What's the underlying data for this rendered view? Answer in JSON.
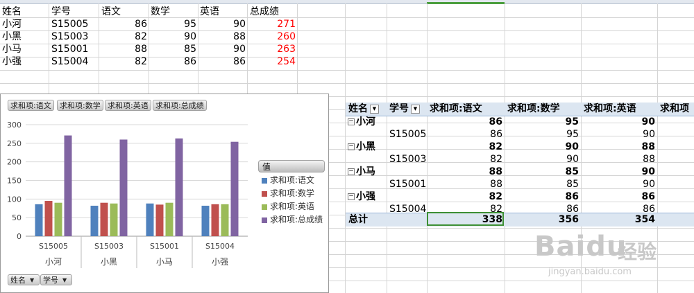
{
  "source_table": {
    "headers": [
      "姓名",
      "学号",
      "语文",
      "数学",
      "英语",
      "总成绩"
    ],
    "rows": [
      {
        "name": "小河",
        "id": "S15005",
        "chinese": "86",
        "math": "95",
        "english": "90",
        "total": "271"
      },
      {
        "name": "小黑",
        "id": "S15003",
        "chinese": "82",
        "math": "90",
        "english": "88",
        "total": "260"
      },
      {
        "name": "小马",
        "id": "S15001",
        "chinese": "88",
        "math": "85",
        "english": "90",
        "total": "263"
      },
      {
        "name": "小强",
        "id": "S15004",
        "chinese": "82",
        "math": "86",
        "english": "86",
        "total": "254"
      }
    ]
  },
  "chart_buttons": [
    "求和项:语文",
    "求和项:数学",
    "求和项:英语",
    "求和项:总成绩"
  ],
  "axis_buttons": [
    "姓名",
    "学号"
  ],
  "legend_title": "值",
  "chart_data": {
    "type": "bar",
    "categories": [
      "S15005",
      "S15003",
      "S15001",
      "S15004"
    ],
    "category_groups": [
      "小河",
      "小黑",
      "小马",
      "小强"
    ],
    "series": [
      {
        "name": "求和项:语文",
        "values": [
          86,
          82,
          88,
          82
        ],
        "color": "#4f81bd"
      },
      {
        "name": "求和项:数学",
        "values": [
          95,
          90,
          85,
          86
        ],
        "color": "#c0504d"
      },
      {
        "name": "求和项:英语",
        "values": [
          90,
          88,
          90,
          86
        ],
        "color": "#9bbb59"
      },
      {
        "name": "求和项:总成绩",
        "values": [
          271,
          260,
          263,
          254
        ],
        "color": "#8064a2"
      }
    ],
    "ylim": [
      0,
      300
    ],
    "yticks": [
      "0",
      "50",
      "100",
      "150",
      "200",
      "250",
      "300"
    ],
    "grid": true,
    "legend_position": "right"
  },
  "pivot": {
    "headers": [
      "姓名",
      "学号",
      "求和项:语文",
      "求和项:数学",
      "求和项:英语",
      "求和项"
    ],
    "groups": [
      {
        "name": "小河",
        "sum": [
          "86",
          "95",
          "90"
        ],
        "id": "S15005",
        "vals": [
          "86",
          "95",
          "90"
        ]
      },
      {
        "name": "小黑",
        "sum": [
          "82",
          "90",
          "88"
        ],
        "id": "S15003",
        "vals": [
          "82",
          "90",
          "88"
        ]
      },
      {
        "name": "小马",
        "sum": [
          "88",
          "85",
          "90"
        ],
        "id": "S15001",
        "vals": [
          "88",
          "85",
          "90"
        ]
      },
      {
        "name": "小强",
        "sum": [
          "82",
          "86",
          "86"
        ],
        "id": "S15004",
        "vals": [
          "82",
          "86",
          "86"
        ]
      }
    ],
    "total_label": "总计",
    "totals": [
      "338",
      "356",
      "354"
    ]
  },
  "watermark": {
    "brand": "Baidu",
    "brand_cn": "经验",
    "url": "jingyan.baidu.com"
  },
  "colors": {
    "accent_green": "#3d8f34",
    "pivot_header": "#dce6f1",
    "total_red": "#ff0000"
  }
}
